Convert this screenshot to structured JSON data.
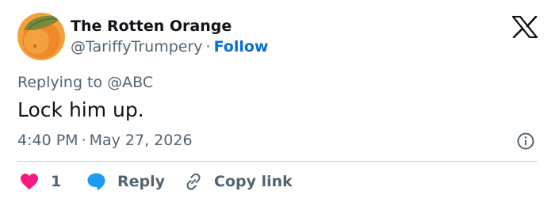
{
  "author": {
    "display_name": "The Rotten Orange",
    "handle": "@TariffyTrumpery",
    "separator": "·",
    "follow_label": "Follow"
  },
  "reply_context": "Replying to @ABC",
  "tweet": {
    "text": "Lock him up.",
    "time": "4:40 PM",
    "separator": "·",
    "date": "May 27, 2026"
  },
  "actions": {
    "like_count": "1",
    "reply_label": "Reply",
    "copy_link_label": "Copy link"
  },
  "icons": {
    "brand": "x-logo-icon",
    "info": "info-icon",
    "like": "heart-icon",
    "reply": "speech-bubble-icon",
    "copy": "link-icon"
  },
  "colors": {
    "follow": "#0a6fd1",
    "heart": "#f91880",
    "reply_bubble": "#1d9bf0",
    "secondary_text": "#536471",
    "primary_text": "#0f1419",
    "divider": "#cfd9de"
  }
}
